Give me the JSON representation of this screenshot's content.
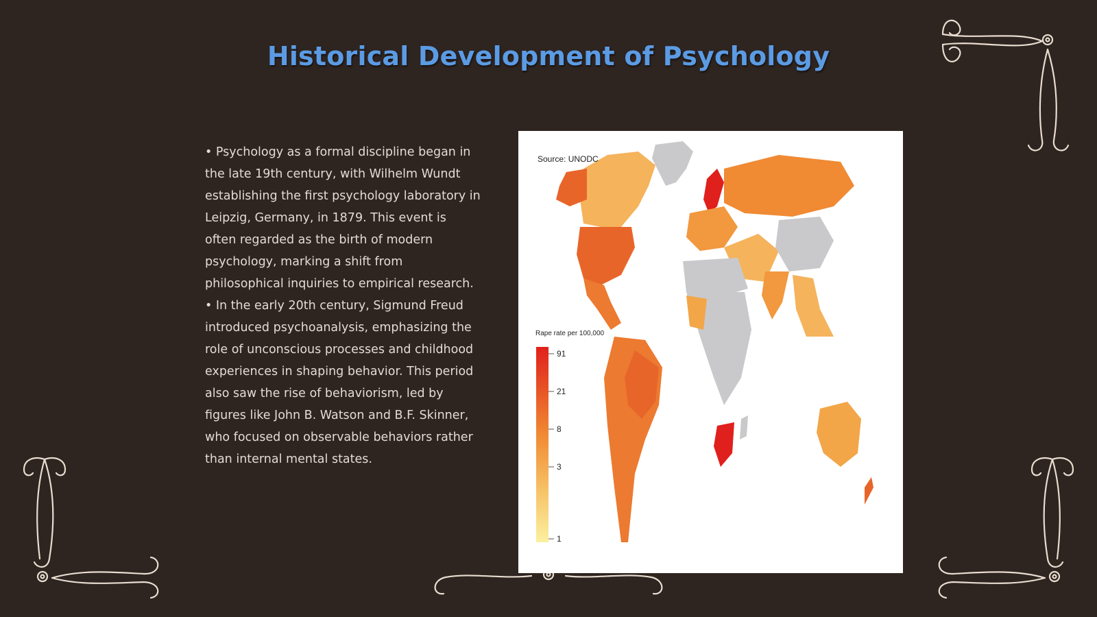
{
  "slide": {
    "title": "Historical Development of Psychology",
    "bullets": [
      "• Psychology as a formal discipline began in the late 19th century, with Wilhelm Wundt establishing the first psychology laboratory in Leipzig, Germany, in 1879. This event is often regarded as the birth of modern psychology, marking a shift from philosophical inquiries to empirical research.",
      "• In the early 20th century, Sigmund Freud introduced psychoanalysis, emphasizing the role of unconscious processes and childhood experiences in shaping behavior. This period also saw the rise of behaviorism, led by figures like John B. Watson and B.F. Skinner, who focused on observable behaviors rather than internal mental states."
    ]
  },
  "map_image": {
    "source_label": "Source: UNODC",
    "legend_title": "Rape rate per 100,000",
    "legend_ticks": [
      "91",
      "21",
      "8",
      "3",
      "1"
    ]
  },
  "colors": {
    "background": "#2e2420",
    "title": "#5b9be4",
    "text": "#e4dcd3",
    "ornament": "#e9ddd0",
    "map_background": "#ffffff",
    "no_data": "#c9c9cb",
    "scale_high": "#e0201c",
    "scale_mid": "#f08a33",
    "scale_low": "#f7c56a"
  }
}
